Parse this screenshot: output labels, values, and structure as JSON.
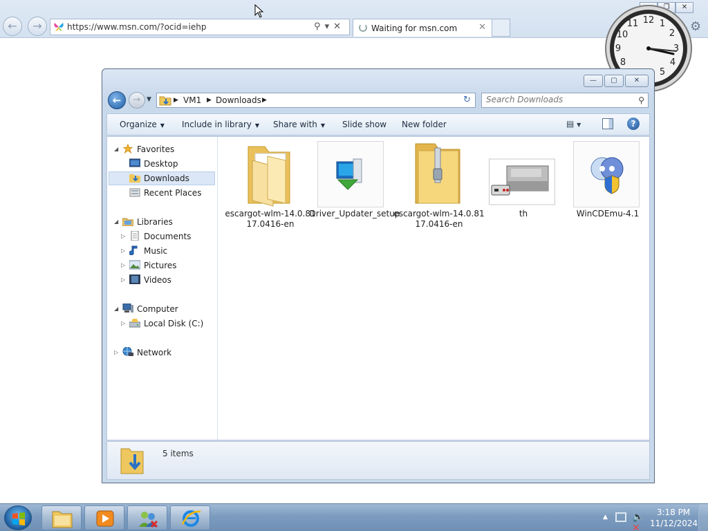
{
  "browser": {
    "url": "https://www.msn.com/?ocid=iehp",
    "tab_title": "Waiting for msn.com"
  },
  "explorer": {
    "breadcrumb": [
      "VM1",
      "Downloads"
    ],
    "search_placeholder": "Search Downloads",
    "toolbar": {
      "organize": "Organize",
      "include_in_library": "Include in library",
      "share_with": "Share with",
      "slide_show": "Slide show",
      "new_folder": "New folder"
    },
    "nav": {
      "favorites": "Favorites",
      "desktop": "Desktop",
      "downloads": "Downloads",
      "recent_places": "Recent Places",
      "libraries": "Libraries",
      "documents": "Documents",
      "music": "Music",
      "pictures": "Pictures",
      "videos": "Videos",
      "computer": "Computer",
      "local_disk": "Local Disk (C:)",
      "network": "Network"
    },
    "files": [
      {
        "name": "escargot-wlm-14.0.8117.0416-en",
        "type": "folder"
      },
      {
        "name": "Driver_Updater_setup",
        "type": "installer"
      },
      {
        "name": "escargot-wlm-14.0.8117.0416-en",
        "type": "zip"
      },
      {
        "name": "th",
        "type": "image"
      },
      {
        "name": "WinCDEmu-4.1",
        "type": "installer"
      }
    ],
    "item_count": "5 items"
  },
  "taskbar": {
    "time": "3:18 PM",
    "date": "11/12/2024"
  }
}
